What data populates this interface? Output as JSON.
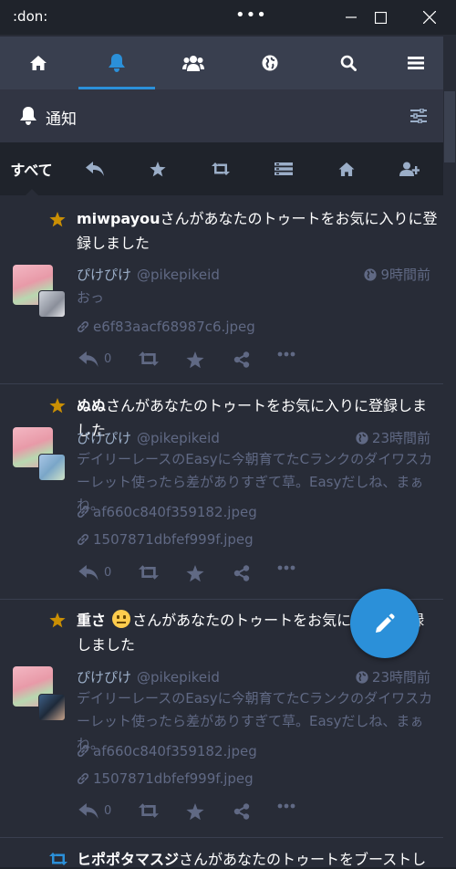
{
  "window": {
    "title": ":don:",
    "menu_dots": "•••"
  },
  "column": {
    "title": "通知"
  },
  "filters": {
    "all_label": "すべて"
  },
  "notifications": [
    {
      "type": "favourite",
      "actor": "miwpayou",
      "message": "さんがあなたのトゥートをお気に入りに登録しました",
      "status": {
        "display_name": "ぴけぴけ",
        "acct": "@pikepikeid",
        "time": "9時間前",
        "content": "おっ",
        "attachments": [
          "e6f83aacf68987c6.jpeg"
        ],
        "reply_count": "0"
      }
    },
    {
      "type": "favourite",
      "actor": "ぬぬ",
      "message": "さんがあなたのトゥートをお気に入りに登録しました",
      "status": {
        "display_name": "ぴけぴけ",
        "acct": "@pikepikeid",
        "time": "23時間前",
        "content": "デイリーレースのEasyに今朝育てたCランクのダイワスカーレット使ったら差がありすぎて草。Easyだしね、まぁね。",
        "attachments": [
          "af660c840f359182.jpeg",
          "1507871dbfef999f.jpeg"
        ],
        "reply_count": "0"
      }
    },
    {
      "type": "favourite",
      "actor": "重さ",
      "message": "さんがあなたのトゥートをお気に入りに登録しました",
      "status": {
        "display_name": "ぴけぴけ",
        "acct": "@pikepikeid",
        "time": "23時間前",
        "content": "デイリーレースのEasyに今朝育てたCランクのダイワスカーレット使ったら差がありすぎて草。Easyだしね、まぁね。",
        "attachments": [
          "af660c840f359182.jpeg",
          "1507871dbfef999f.jpeg"
        ],
        "reply_count": "0"
      }
    },
    {
      "type": "reblog",
      "actor": "ヒポポタマスジ",
      "message": "さんがあなたのトゥートをブーストしました"
    }
  ],
  "colors": {
    "accent": "#2b90d9",
    "star": "#ca8f04",
    "bg": "#282c37"
  }
}
